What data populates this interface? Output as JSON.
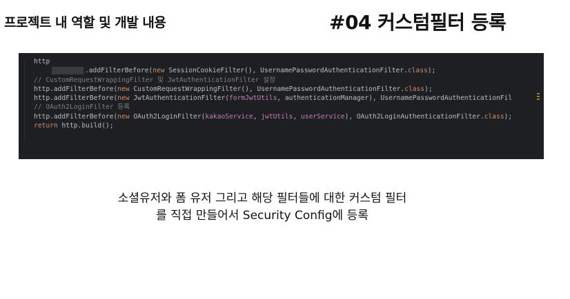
{
  "header": {
    "section_title": "프로젝트 내 역할 및 개발 내용",
    "slide_title": "#04 커스텀필터 등록"
  },
  "code": {
    "line1": "http",
    "line2_call": ".addFilterBefore(",
    "line2_new": "new ",
    "line2_rest": "SessionCookieFilter(), UsernamePasswordAuthenticationFilter.",
    "line2_class": "class",
    "line2_end": ");",
    "line3": "// CustomRequestWrappingFilter 및 JwtAuthenticationFilter 설정",
    "line4_start": "http.addFilterBefore(",
    "line4_new": "new ",
    "line4_rest": "CustomRequestWrappingFilter(), UsernamePasswordAuthenticationFilter.",
    "line4_class": "class",
    "line4_end": ");",
    "line5_start": "http.addFilterBefore(",
    "line5_new": "new ",
    "line5_mid": "JwtAuthenticationFilter(",
    "line5_param": "formJwtUtils",
    "line5_rest": ", authenticationManager), UsernamePasswordAuthenticationFil",
    "line6": "// OAuth2LoginFilter 등록",
    "line7_start": "http.addFilterBefore(",
    "line7_new": "new ",
    "line7_mid": "OAuth2LoginFilter(",
    "line7_p1": "kakaoService",
    "line7_sep1": ", ",
    "line7_p2": "jwtUtils",
    "line7_sep2": ", ",
    "line7_p3": "userService",
    "line7_rest": "), OAuth2LoginAuthenticationFilter.",
    "line7_class": "class",
    "line7_end": ");",
    "line8_kw": "return ",
    "line8_rest": "http.build();"
  },
  "description": {
    "line1": "소셜유저와 폼 유저 그리고 해당 필터들에 대한 커스텀 필터",
    "line2": "를 직접 만들어서 Security Config에 등록"
  },
  "colors": {
    "code_background": "#1e1f22",
    "keyword": "#cf8e6d",
    "comment": "#7a7e85",
    "parameter": "#c77dbb",
    "text": "#bcbec4"
  }
}
